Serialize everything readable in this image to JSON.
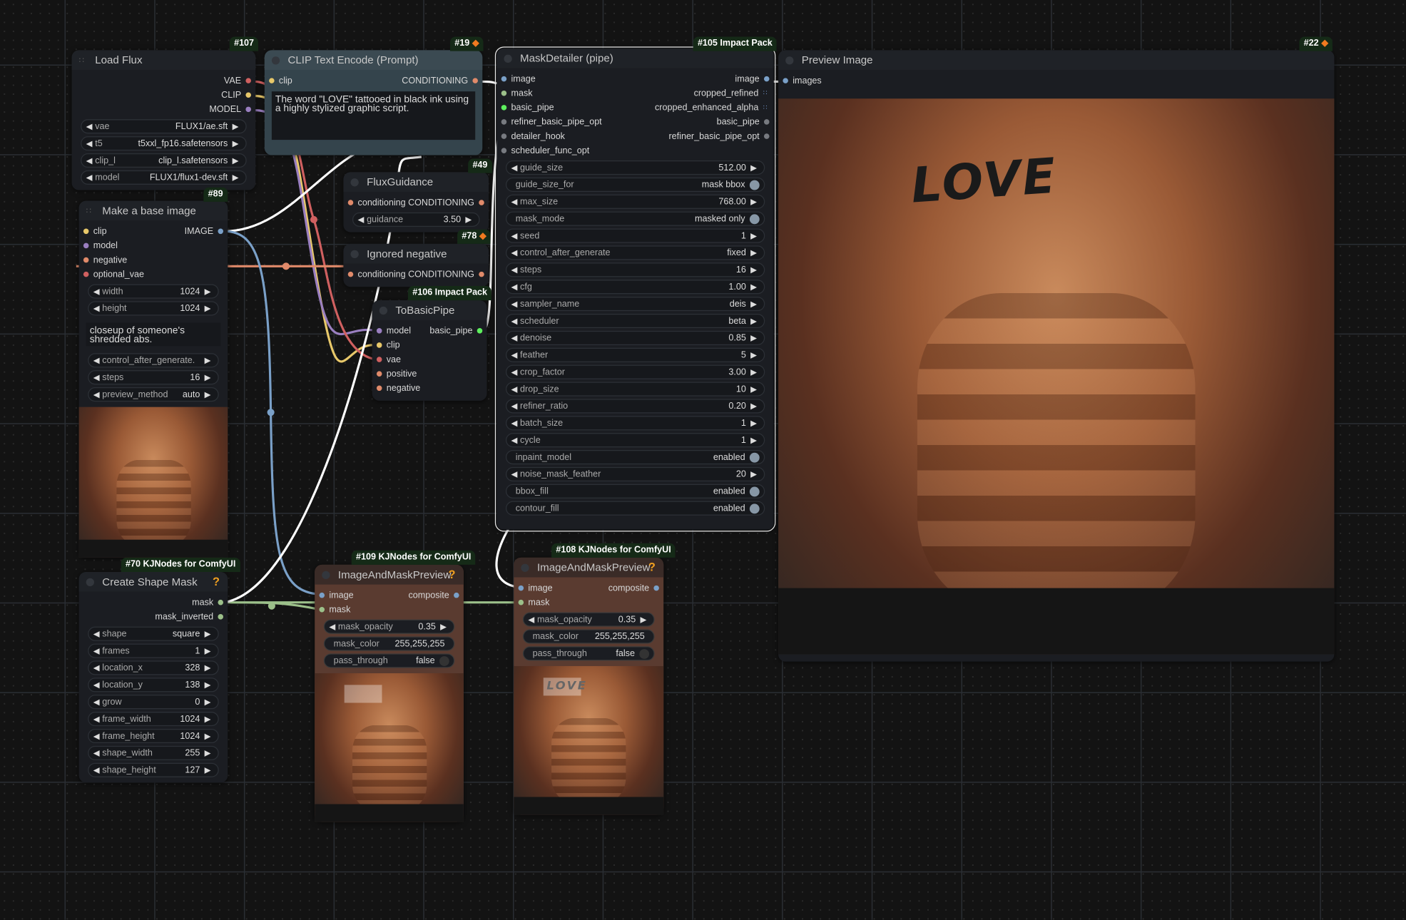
{
  "colors": {
    "clip": "#e8c86a",
    "model": "#9a7fc0",
    "vae": "#d06060",
    "conditioning": "#e08a6a",
    "image": "#7aa0c8",
    "mask": "#9cc08a",
    "basic_pipe": "#5ef05e",
    "optional": "#777a80"
  },
  "nodes": [
    {
      "key": "load_flux",
      "badge": "#107",
      "title": "Load Flux",
      "header_icon": "grip",
      "inputs": [],
      "outputs": [
        {
          "label": "VAE",
          "color": "vae"
        },
        {
          "label": "CLIP",
          "color": "clip"
        },
        {
          "label": "MODEL",
          "color": "model"
        }
      ],
      "widgets": [
        {
          "label": "vae",
          "value": "FLUX1/ae.sft",
          "type": "combo"
        },
        {
          "label": "t5",
          "value": "t5xxl_fp16.safetensors",
          "type": "combo"
        },
        {
          "label": "clip_l",
          "value": "clip_l.safetensors",
          "type": "combo"
        },
        {
          "label": "model",
          "value": "FLUX1/flux1-dev.sft",
          "type": "combo"
        }
      ]
    },
    {
      "key": "clip_text",
      "badge": "#19",
      "badge_fox": true,
      "title": "CLIP Text Encode (Prompt)",
      "inputs": [
        {
          "label": "clip",
          "color": "clip"
        }
      ],
      "outputs": [
        {
          "label": "CONDITIONING",
          "color": "conditioning"
        }
      ],
      "widgets": [],
      "text": "The word \"LOVE\" tattooed in black ink using a highly stylized graphic script."
    },
    {
      "key": "mask_detailer",
      "badge": "#105 Impact Pack",
      "title": "MaskDetailer (pipe)",
      "selected": true,
      "inputs": [
        {
          "label": "image",
          "color": "image"
        },
        {
          "label": "mask",
          "color": "mask"
        },
        {
          "label": "basic_pipe",
          "color": "basic_pipe"
        },
        {
          "label": "refiner_basic_pipe_opt",
          "color": "optional"
        },
        {
          "label": "detailer_hook",
          "color": "optional"
        },
        {
          "label": "scheduler_func_opt",
          "color": "optional"
        }
      ],
      "outputs": [
        {
          "label": "image",
          "color": "image"
        },
        {
          "label": "cropped_refined",
          "color": "grid"
        },
        {
          "label": "cropped_enhanced_alpha",
          "color": "grid"
        },
        {
          "label": "basic_pipe",
          "color": "optional"
        },
        {
          "label": "refiner_basic_pipe_opt",
          "color": "optional"
        }
      ],
      "widgets": [
        {
          "label": "guide_size",
          "value": "512.00",
          "type": "combo"
        },
        {
          "label": "guide_size_for",
          "value": "mask bbox",
          "type": "toggle"
        },
        {
          "label": "max_size",
          "value": "768.00",
          "type": "combo"
        },
        {
          "label": "mask_mode",
          "value": "masked only",
          "type": "toggle"
        },
        {
          "label": "seed",
          "value": "1",
          "type": "combo"
        },
        {
          "label": "control_after_generate",
          "value": "fixed",
          "type": "combo"
        },
        {
          "label": "steps",
          "value": "16",
          "type": "combo"
        },
        {
          "label": "cfg",
          "value": "1.00",
          "type": "combo"
        },
        {
          "label": "sampler_name",
          "value": "deis",
          "type": "combo"
        },
        {
          "label": "scheduler",
          "value": "beta",
          "type": "combo"
        },
        {
          "label": "denoise",
          "value": "0.85",
          "type": "combo"
        },
        {
          "label": "feather",
          "value": "5",
          "type": "combo"
        },
        {
          "label": "crop_factor",
          "value": "3.00",
          "type": "combo"
        },
        {
          "label": "drop_size",
          "value": "10",
          "type": "combo"
        },
        {
          "label": "refiner_ratio",
          "value": "0.20",
          "type": "combo"
        },
        {
          "label": "batch_size",
          "value": "1",
          "type": "combo"
        },
        {
          "label": "cycle",
          "value": "1",
          "type": "combo"
        },
        {
          "label": "inpaint_model",
          "value": "enabled",
          "type": "toggle"
        },
        {
          "label": "noise_mask_feather",
          "value": "20",
          "type": "combo"
        },
        {
          "label": "bbox_fill",
          "value": "enabled",
          "type": "toggle"
        },
        {
          "label": "contour_fill",
          "value": "enabled",
          "type": "toggle"
        }
      ]
    },
    {
      "key": "preview",
      "badge": "#22",
      "badge_fox": true,
      "title": "Preview Image",
      "inputs": [
        {
          "label": "images",
          "color": "image"
        }
      ],
      "outputs": [],
      "widgets": [],
      "image": {
        "tattoo": "LOVE"
      }
    },
    {
      "key": "flux_guidance",
      "badge": "#49",
      "title": "FluxGuidance",
      "inputs": [
        {
          "label": "conditioning",
          "color": "conditioning"
        }
      ],
      "outputs": [
        {
          "label": "CONDITIONING",
          "color": "conditioning"
        }
      ],
      "widgets": [
        {
          "label": "guidance",
          "value": "3.50",
          "type": "combo"
        }
      ]
    },
    {
      "key": "ignored_negative",
      "badge": "#78",
      "badge_fox": true,
      "title": "Ignored negative",
      "inputs": [
        {
          "label": "conditioning",
          "color": "conditioning"
        }
      ],
      "outputs": [
        {
          "label": "CONDITIONING",
          "color": "conditioning"
        }
      ],
      "widgets": []
    },
    {
      "key": "to_basic_pipe",
      "badge": "#106 Impact Pack",
      "title": "ToBasicPipe",
      "inputs": [
        {
          "label": "model",
          "color": "model"
        },
        {
          "label": "clip",
          "color": "clip"
        },
        {
          "label": "vae",
          "color": "vae"
        },
        {
          "label": "positive",
          "color": "conditioning"
        },
        {
          "label": "negative",
          "color": "conditioning"
        }
      ],
      "outputs": [
        {
          "label": "basic_pipe",
          "color": "basic_pipe"
        }
      ],
      "widgets": []
    },
    {
      "key": "base_image",
      "badge": "#89",
      "title": "Make a base image",
      "header_icon": "grip",
      "inputs": [
        {
          "label": "clip",
          "color": "clip"
        },
        {
          "label": "model",
          "color": "model"
        },
        {
          "label": "negative",
          "color": "conditioning"
        },
        {
          "label": "optional_vae",
          "color": "vae"
        }
      ],
      "outputs": [
        {
          "label": "IMAGE",
          "color": "image"
        }
      ],
      "widgets": [
        {
          "label": "width",
          "value": "1024",
          "type": "combo"
        },
        {
          "label": "height",
          "value": "1024",
          "type": "combo"
        }
      ],
      "text": "closeup of someone's shredded abs.",
      "widgets2": [
        {
          "label": "control_after_generate.",
          "value": "",
          "type": "combo"
        },
        {
          "label": "steps",
          "value": "16",
          "type": "combo"
        },
        {
          "label": "preview_method",
          "value": "auto",
          "type": "combo"
        }
      ],
      "image": {}
    },
    {
      "key": "shape_mask",
      "badge": "#70 KJNodes for ComfyUI",
      "title": "Create Shape Mask",
      "help": "?",
      "inputs": [],
      "outputs": [
        {
          "label": "mask",
          "color": "mask"
        },
        {
          "label": "mask_inverted",
          "color": "mask"
        }
      ],
      "widgets": [
        {
          "label": "shape",
          "value": "square",
          "type": "combo"
        },
        {
          "label": "frames",
          "value": "1",
          "type": "combo"
        },
        {
          "label": "location_x",
          "value": "328",
          "type": "combo"
        },
        {
          "label": "location_y",
          "value": "138",
          "type": "combo"
        },
        {
          "label": "grow",
          "value": "0",
          "type": "combo"
        },
        {
          "label": "frame_width",
          "value": "1024",
          "type": "combo"
        },
        {
          "label": "frame_height",
          "value": "1024",
          "type": "combo"
        },
        {
          "label": "shape_width",
          "value": "255",
          "type": "combo"
        },
        {
          "label": "shape_height",
          "value": "127",
          "type": "combo"
        }
      ]
    },
    {
      "key": "iamp_109",
      "badge": "#109 KJNodes for ComfyUI",
      "title": "ImageAndMaskPreview",
      "help": "?",
      "brown": true,
      "inputs": [
        {
          "label": "image",
          "color": "image"
        },
        {
          "label": "mask",
          "color": "mask"
        }
      ],
      "outputs": [
        {
          "label": "composite",
          "color": "image"
        }
      ],
      "widgets": [
        {
          "label": "mask_opacity",
          "value": "0.35",
          "type": "combo"
        },
        {
          "label": "mask_color",
          "value": "255,255,255",
          "type": "text"
        },
        {
          "label": "pass_through",
          "value": "false",
          "type": "toggle_off"
        }
      ],
      "image": {
        "mask_overlay": true
      }
    },
    {
      "key": "iamp_108",
      "badge": "#108 KJNodes for ComfyUI",
      "title": "ImageAndMaskPreview",
      "help": "?",
      "brown": true,
      "inputs": [
        {
          "label": "image",
          "color": "image"
        },
        {
          "label": "mask",
          "color": "mask"
        }
      ],
      "outputs": [
        {
          "label": "composite",
          "color": "image"
        }
      ],
      "widgets": [
        {
          "label": "mask_opacity",
          "value": "0.35",
          "type": "combo"
        },
        {
          "label": "mask_color",
          "value": "255,255,255",
          "type": "text"
        },
        {
          "label": "pass_through",
          "value": "false",
          "type": "toggle_off"
        }
      ],
      "image": {
        "mask_overlay": true,
        "tattoo": "LOVE"
      }
    }
  ]
}
